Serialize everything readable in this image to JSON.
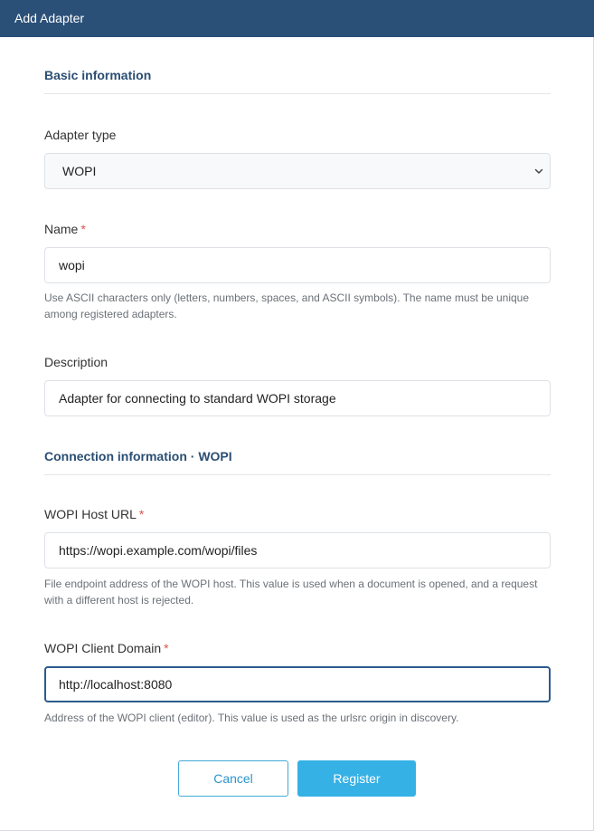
{
  "dialog": {
    "title": "Add Adapter"
  },
  "basic": {
    "section_title": "Basic information",
    "adapter_type": {
      "label": "Adapter type",
      "selected": "WOPI"
    },
    "name": {
      "label": "Name",
      "required_mark": "*",
      "value": "wopi",
      "help": "Use ASCII characters only (letters, numbers, spaces, and ASCII symbols). The name must be unique among registered adapters."
    },
    "description": {
      "label": "Description",
      "value": "Adapter for connecting to standard WOPI storage"
    }
  },
  "connection": {
    "section_title": "Connection information · WOPI",
    "host_url": {
      "label": "WOPI Host URL",
      "required_mark": "*",
      "value": "https://wopi.example.com/wopi/files",
      "help": "File endpoint address of the WOPI host. This value is used when a document is opened, and a request with a different host is rejected."
    },
    "client_domain": {
      "label": "WOPI Client Domain",
      "required_mark": "*",
      "value": "http://localhost:8080",
      "help": "Address of the WOPI client (editor). This value is used as the urlsrc origin in discovery."
    }
  },
  "actions": {
    "cancel_label": "Cancel",
    "register_label": "Register"
  },
  "colors": {
    "titlebar": "#2b5078",
    "section_title": "#2b4e73",
    "required": "#d9534f",
    "primary_button": "#36b1e6",
    "focus_border": "#2b5b8f"
  },
  "icons": {
    "select_caret": "chevron-down-icon"
  }
}
